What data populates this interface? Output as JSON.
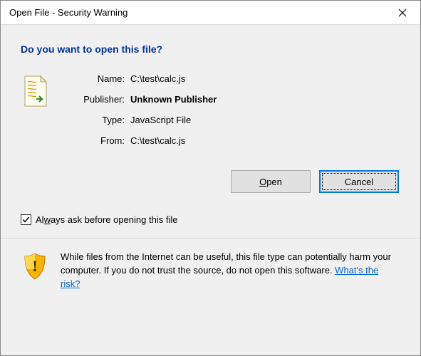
{
  "titlebar": {
    "title": "Open File - Security Warning"
  },
  "heading": "Do you want to open this file?",
  "details": {
    "name_label": "Name:",
    "name_value": "C:\\test\\calc.js",
    "publisher_label": "Publisher:",
    "publisher_value": "Unknown Publisher",
    "type_label": "Type:",
    "type_value": "JavaScript File",
    "from_label": "From:",
    "from_value": "C:\\test\\calc.js"
  },
  "buttons": {
    "open_prefix": "O",
    "open_rest": "pen",
    "cancel": "Cancel"
  },
  "checkbox": {
    "checked": true,
    "pre": "Al",
    "ul": "w",
    "post": "ays ask before opening this file"
  },
  "warning": {
    "text": "While files from the Internet can be useful, this file type can potentially harm your computer. If you do not trust the source, do not open this software. ",
    "link": "What's the risk?"
  }
}
